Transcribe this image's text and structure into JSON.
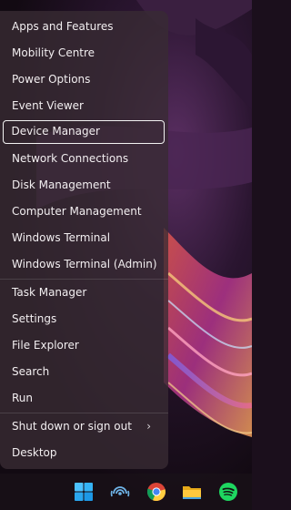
{
  "menu": {
    "items": [
      {
        "label": "Apps and Features"
      },
      {
        "label": "Mobility Centre"
      },
      {
        "label": "Power Options"
      },
      {
        "label": "Event Viewer"
      },
      {
        "label": "Device Manager",
        "selected": true
      },
      {
        "label": "Network Connections"
      },
      {
        "label": "Disk Management"
      },
      {
        "label": "Computer Management"
      },
      {
        "label": "Windows Terminal"
      },
      {
        "label": "Windows Terminal (Admin)"
      },
      {
        "label": "Task Manager"
      },
      {
        "label": "Settings"
      },
      {
        "label": "File Explorer"
      },
      {
        "label": "Search"
      },
      {
        "label": "Run"
      },
      {
        "label": "Shut down or sign out",
        "submenu": true
      },
      {
        "label": "Desktop"
      }
    ],
    "submenu_glyph": "›"
  },
  "taskbar": {
    "icons": [
      "windows-start-icon",
      "wireless-icon",
      "chrome-icon",
      "file-explorer-icon",
      "spotify-icon"
    ]
  },
  "colors": {
    "menu_background": "#382b33",
    "menu_text": "#f2eef0",
    "selection_border": "#f3f3f3",
    "start_blue": "#4cc2ff",
    "folder_yellow": "#ffc83d",
    "spotify_green": "#1ed760"
  }
}
